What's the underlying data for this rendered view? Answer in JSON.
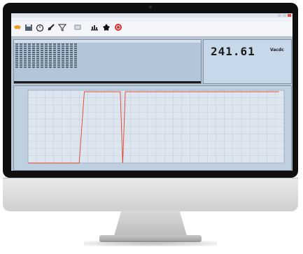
{
  "readout": {
    "value": "241.61",
    "unit": "Vacdc"
  },
  "chart_data": {
    "type": "line",
    "series": [
      {
        "values": [
          [
            0,
            0
          ],
          [
            20,
            0
          ],
          [
            22,
            98
          ],
          [
            36,
            98
          ],
          [
            37,
            0
          ],
          [
            38,
            98
          ],
          [
            98,
            98
          ]
        ],
        "color": "#e0412c"
      }
    ],
    "xlim": [
      0,
      100
    ],
    "ylim": [
      0,
      100
    ],
    "grid": true
  },
  "colors": {
    "accent": "#e0412c",
    "screen": "#bcc7d3"
  },
  "icons": [
    "open-icon",
    "save-icon",
    "timer-icon",
    "probe-icon",
    "filter-icon",
    "file-icon",
    "chart-icon",
    "alarm-icon",
    "stop-icon"
  ]
}
